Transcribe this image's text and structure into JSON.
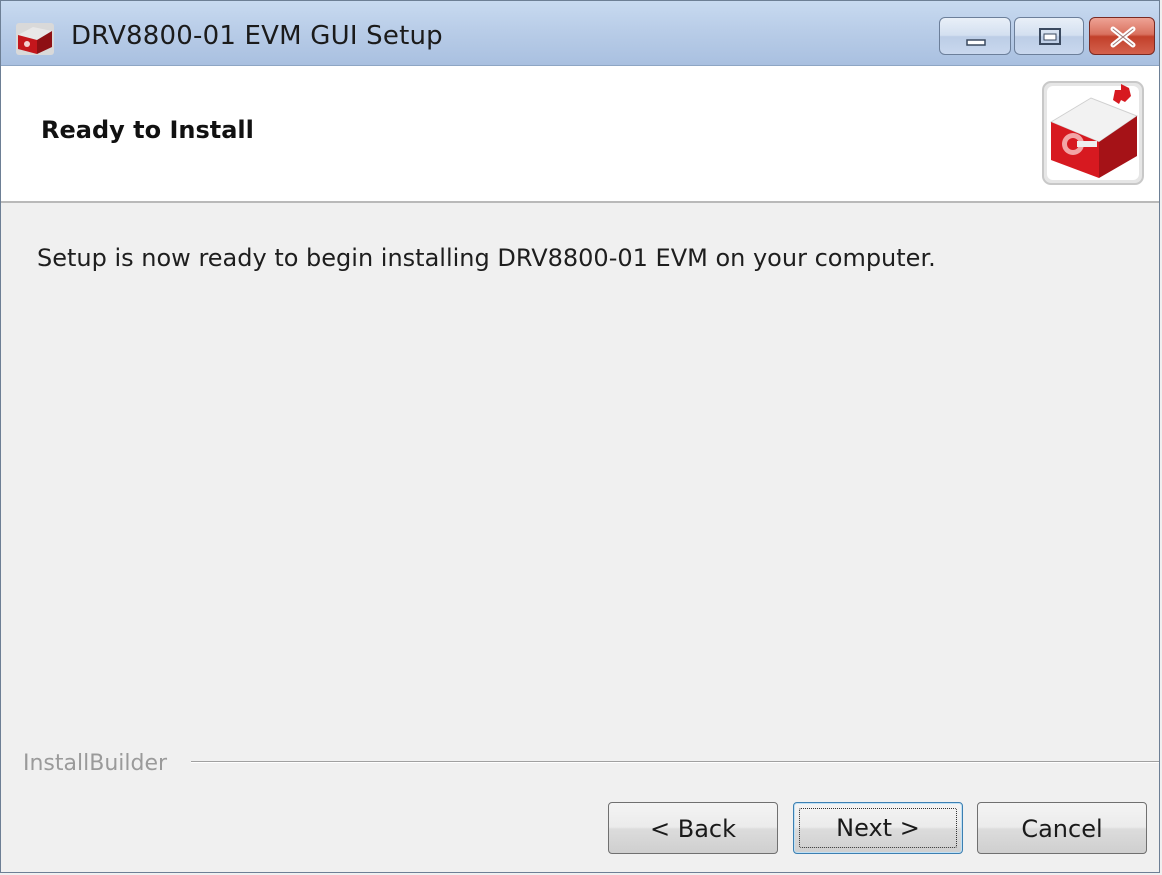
{
  "window": {
    "title": "DRV8800-01 EVM GUI Setup",
    "controls": [
      "minimize-icon",
      "maximize-icon",
      "close-icon"
    ]
  },
  "header": {
    "title": "Ready to Install",
    "logo": "ti-motor-logo"
  },
  "main": {
    "message": "Setup is now ready to begin installing DRV8800-01 EVM on your computer."
  },
  "footer": {
    "branding": "InstallBuilder",
    "back_label": "< Back",
    "next_label": "Next >",
    "cancel_label": "Cancel"
  },
  "colors": {
    "titlebar": "#b9cde8",
    "close_button": "#c2402b",
    "logo_red": "#cc1f1f",
    "background": "#f0f0f0"
  }
}
